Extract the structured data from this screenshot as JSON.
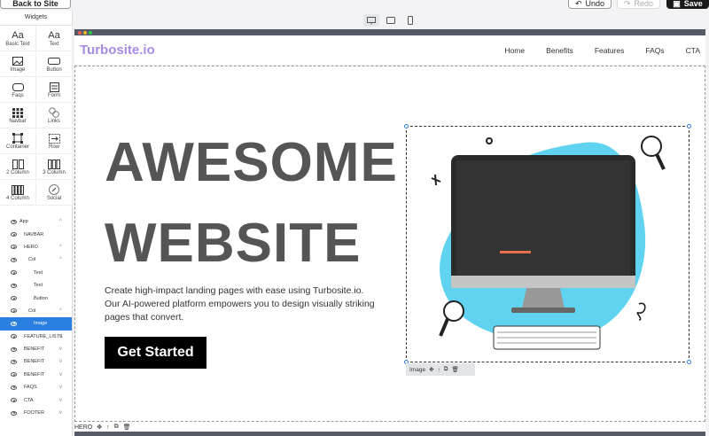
{
  "toolbar": {
    "back_label": "Back to Site",
    "undo_label": "Undo",
    "redo_label": "Redo",
    "save_label": "Save"
  },
  "sidebar": {
    "title": "Widgets",
    "widgets": [
      {
        "label": "Basic Text",
        "icon": "Aa"
      },
      {
        "label": "Text",
        "icon": "Aa"
      },
      {
        "label": "Image",
        "icon": "image-icon"
      },
      {
        "label": "Button",
        "icon": "button-icon"
      },
      {
        "label": "Faqs",
        "icon": "faqs-icon"
      },
      {
        "label": "Form",
        "icon": "form-icon"
      },
      {
        "label": "Navbar",
        "icon": "navbar-icon"
      },
      {
        "label": "Links",
        "icon": "links-icon"
      },
      {
        "label": "Container",
        "icon": "container-icon"
      },
      {
        "label": "Row",
        "icon": "row-icon"
      },
      {
        "label": "2 Column",
        "icon": "two-column-icon"
      },
      {
        "label": "3 Column",
        "icon": "three-column-icon"
      },
      {
        "label": "4 Column",
        "icon": "four-column-icon"
      },
      {
        "label": "Social",
        "icon": "social-icon"
      }
    ],
    "tree": [
      {
        "label": "App",
        "chev": "^"
      },
      {
        "label": "NAVBAR",
        "chev": ""
      },
      {
        "label": "HERO",
        "chev": "^"
      },
      {
        "label": "Col",
        "chev": "^"
      },
      {
        "label": "Text",
        "chev": ""
      },
      {
        "label": "Text",
        "chev": ""
      },
      {
        "label": "Button",
        "chev": ""
      },
      {
        "label": "Col",
        "chev": "^"
      },
      {
        "label": "Image",
        "chev": ""
      },
      {
        "label": "FEATURE_LISTS",
        "chev": "v"
      },
      {
        "label": "BENEFIT",
        "chev": "v"
      },
      {
        "label": "BENEFIT",
        "chev": "v"
      },
      {
        "label": "BENEFIT",
        "chev": "v"
      },
      {
        "label": "FAQS",
        "chev": "v"
      },
      {
        "label": "CTA",
        "chev": "v"
      },
      {
        "label": "FOOTER",
        "chev": "v"
      }
    ]
  },
  "site": {
    "logo": "Turbosite.io",
    "nav": [
      "Home",
      "Benefits",
      "Features",
      "FAQs",
      "CTA"
    ],
    "headline_1": "AWESOME",
    "headline_2": "WEBSITE",
    "description": "Create high-impact landing pages with ease using Turbosite.io. Our AI-powered platform empowers you to design visually striking pages that convert.",
    "cta_label": "Get Started"
  },
  "selection": {
    "image_tag": "Image",
    "hero_tag": "HERO"
  },
  "colors": {
    "accent": "#2b7fe0",
    "logo": "#a98be6",
    "blob": "#5fd3f0",
    "frame_bar": "#555b66"
  }
}
